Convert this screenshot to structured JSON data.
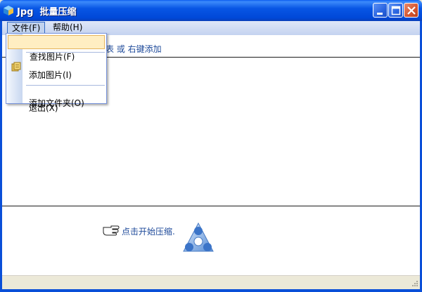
{
  "window": {
    "title": "Jpg  批量压缩"
  },
  "menubar": {
    "items": [
      {
        "label": "文件(F)"
      },
      {
        "label": "帮助(H)"
      }
    ]
  },
  "dropdown": {
    "items": [
      {
        "label": "查找图片(F)",
        "highlighted": true
      },
      {
        "label": "添加图片(I)"
      },
      {
        "label": "添加文件夹(O)"
      },
      {
        "label": "退出(X)"
      }
    ]
  },
  "main": {
    "hint": "表 或 右键添加",
    "start_hint": "点击开始压缩."
  },
  "colors": {
    "titlebar": "#0856e4",
    "highlight": "#ffeec2",
    "hint_text": "#1e4a9a"
  },
  "icons": {
    "app": "cube-icon",
    "minimize": "minimize-icon",
    "maximize": "maximize-icon",
    "close": "close-icon",
    "folder": "folder-icon",
    "hand": "pointing-hand-icon",
    "logo": "triangle-logo-icon",
    "grip": "resize-grip-icon"
  }
}
